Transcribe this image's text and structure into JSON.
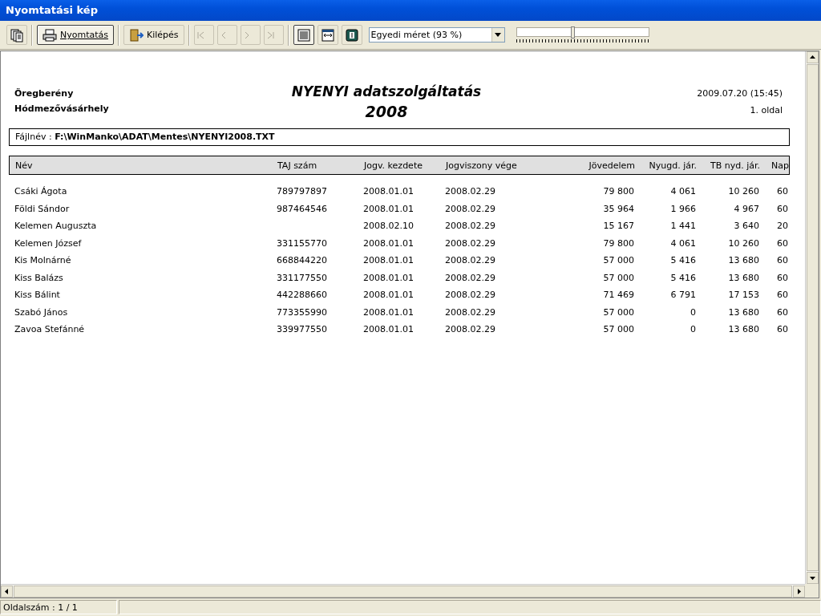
{
  "window": {
    "title": "Nyomtatási kép"
  },
  "toolbar": {
    "print_button": {
      "label": "Nyomtatás",
      "selected": true
    },
    "exit_button": {
      "label": "Kilépés"
    },
    "nav_buttons": [
      {
        "kind": "first",
        "disabled": true
      },
      {
        "kind": "prev",
        "disabled": true
      },
      {
        "kind": "next",
        "disabled": true
      },
      {
        "kind": "last",
        "disabled": true
      }
    ],
    "view_buttons": [
      {
        "kind": "page",
        "selected": true
      },
      {
        "kind": "width",
        "selected": false
      },
      {
        "kind": "book",
        "selected": false
      }
    ],
    "zoom_select": {
      "value": "Egyedi méret (93 %)"
    },
    "zoom_slider": {
      "level": 0.43
    }
  },
  "report": {
    "left_lines": [
      "Öregberény",
      "Hódmezővásárhely"
    ],
    "title_lines": [
      "NYENYI adatszolgáltatás",
      "2008"
    ],
    "right_lines": [
      "2009.07.20 (15:45)",
      "1. oldal"
    ],
    "file_line": "Fájlnév : **F:\\WinManko\\ADAT\\Mentes\\NYENYI2008.TXT**",
    "table": {
      "columns": [
        "Név",
        "TAJ szám",
        "Jogv. kezdete",
        "Jogviszony vége",
        "Jövedelem",
        "Nyugd. jár.",
        "TB nyd. jár.",
        "Nap"
      ],
      "rows": [
        [
          "Csáki Ágota",
          "789797897",
          "2008.01.01",
          "2008.02.29",
          "79 800",
          "4 061",
          "10 260",
          "60"
        ],
        [
          "Földi Sándor",
          "987464546",
          "2008.01.01",
          "2008.02.29",
          "35 964",
          "1 966",
          "4 967",
          "60"
        ],
        [
          "Kelemen Auguszta",
          "",
          "2008.02.10",
          "2008.02.29",
          "15 167",
          "1 441",
          "3 640",
          "20"
        ],
        [
          "Kelemen József",
          "331155770",
          "2008.01.01",
          "2008.02.29",
          "79 800",
          "4 061",
          "10 260",
          "60"
        ],
        [
          "Kis Molnárné",
          "668844220",
          "2008.01.01",
          "2008.02.29",
          "57 000",
          "5 416",
          "13 680",
          "60"
        ],
        [
          "Kiss Balázs",
          "331177550",
          "2008.01.01",
          "2008.02.29",
          "57 000",
          "5 416",
          "13 680",
          "60"
        ],
        [
          "Kiss Bálint",
          "442288660",
          "2008.01.01",
          "2008.02.29",
          "71 469",
          "6 791",
          "17 153",
          "60"
        ],
        [
          "Szabó János",
          "773355990",
          "2008.01.01",
          "2008.02.29",
          "57 000",
          "0",
          "13 680",
          "60"
        ],
        [
          "Zavoa Stefánné",
          "339977550",
          "2008.01.01",
          "2008.02.29",
          "57 000",
          "0",
          "13 680",
          "60"
        ]
      ]
    }
  },
  "status_bar": {
    "page_count": "Oldalszám : 1 / 1"
  }
}
